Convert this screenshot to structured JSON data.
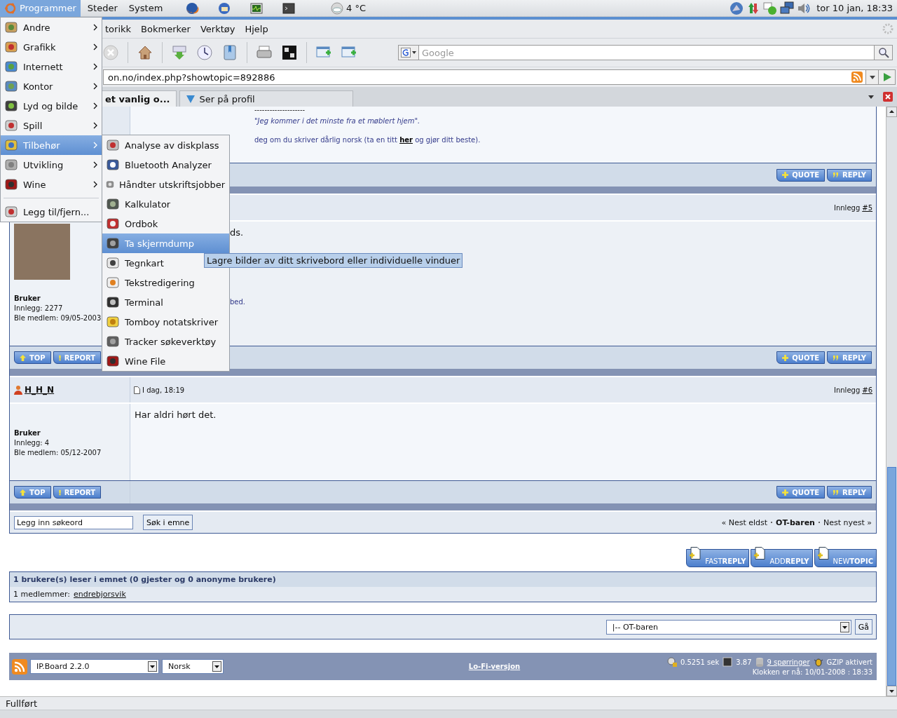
{
  "top_panel": {
    "menus": [
      {
        "label": "Programmer",
        "selected": true
      },
      {
        "label": "Steder",
        "selected": false
      },
      {
        "label": "System",
        "selected": false
      }
    ],
    "weather": "4 °C",
    "clock": "tor 10 jan, 18:33"
  },
  "app_menu": [
    {
      "label": "Andre",
      "submenu": true,
      "selected": false,
      "separator_before": false
    },
    {
      "label": "Grafikk",
      "submenu": true,
      "selected": false,
      "separator_before": false
    },
    {
      "label": "Internett",
      "submenu": true,
      "selected": false,
      "separator_before": false
    },
    {
      "label": "Kontor",
      "submenu": true,
      "selected": false,
      "separator_before": false
    },
    {
      "label": "Lyd og bilde",
      "submenu": true,
      "selected": false,
      "separator_before": false
    },
    {
      "label": "Spill",
      "submenu": true,
      "selected": false,
      "separator_before": false
    },
    {
      "label": "Tilbehør",
      "submenu": true,
      "selected": true,
      "separator_before": false
    },
    {
      "label": "Utvikling",
      "submenu": true,
      "selected": false,
      "separator_before": false
    },
    {
      "label": "Wine",
      "submenu": true,
      "selected": false,
      "separator_before": false
    },
    {
      "label": "Legg til/fjern...",
      "submenu": false,
      "selected": false,
      "separator_before": true
    }
  ],
  "submenu": [
    {
      "label": "Analyse av diskplass",
      "selected": false
    },
    {
      "label": "Bluetooth Analyzer",
      "selected": false
    },
    {
      "label": "Håndter utskriftsjobber",
      "selected": false
    },
    {
      "label": "Kalkulator",
      "selected": false
    },
    {
      "label": "Ordbok",
      "selected": false
    },
    {
      "label": "Ta skjermdump",
      "selected": true
    },
    {
      "label": "Tegnkart",
      "selected": false
    },
    {
      "label": "Tekstredigering",
      "selected": false
    },
    {
      "label": "Terminal",
      "selected": false
    },
    {
      "label": "Tomboy notatskriver",
      "selected": false
    },
    {
      "label": "Tracker søkeverktøy",
      "selected": false
    },
    {
      "label": "Wine File",
      "selected": false
    }
  ],
  "tooltip": "Lagre bilder av ditt skrivebord eller individuelle vinduer",
  "browser": {
    "menubar": [
      "torikk",
      "Bokmerker",
      "Verktøy",
      "Hjelp"
    ],
    "search": {
      "placeholder": "Google"
    },
    "url": "on.no/index.php?showtopic=892886",
    "tabs": [
      {
        "label": "et vanlig o...",
        "selected": true
      },
      {
        "label": "Ser på profil",
        "selected": false
      }
    ],
    "status": "Fullført"
  },
  "previous_post": {
    "signature_line": "--------------------",
    "quote": "\"Jeg kommer i det minste fra et møblert hjem\".",
    "note": {
      "before": "deg om du skriver dårlig norsk (ta en titt",
      "link": "her",
      "after": "og gjør ditt beste)."
    },
    "buttons_right": [
      "QUOTE",
      "REPLY"
    ]
  },
  "posts": [
    {
      "post_label": "Innlegg",
      "number": "#5",
      "avatar": true,
      "role": "Bruker",
      "post_count": "Innlegg: 2277",
      "joined": "Ble medlem: 09/05-2003",
      "body": [
        {
          "kind": "text",
          "text": "ds."
        },
        {
          "kind": "link",
          "text": "bed."
        }
      ],
      "buttons_left": [
        "TOP",
        "REPORT"
      ],
      "buttons_right": [
        "QUOTE",
        "REPLY"
      ]
    },
    {
      "author": "H_H_N",
      "date": "I dag, 18:19",
      "post_label": "Innlegg",
      "number": "#6",
      "avatar": false,
      "role": "Bruker",
      "post_count": "Innlegg: 4",
      "joined": "Ble medlem: 05/12-2007",
      "body": [
        {
          "kind": "text",
          "text": "Har aldri hørt det."
        }
      ],
      "buttons_left": [
        "TOP",
        "REPORT"
      ],
      "buttons_right": [
        "QUOTE",
        "REPLY"
      ]
    }
  ],
  "topic_search": {
    "placeholder": "Legg inn søkeord",
    "button": "Søk i emne",
    "nav_prev": "« Nest eldst",
    "nav_forum": "OT-baren",
    "nav_next": "Nest nyest »"
  },
  "topic_buttons": [
    {
      "light": "FAST",
      "bold": "REPLY"
    },
    {
      "light": "ADD",
      "bold": "REPLY"
    },
    {
      "light": "NEW",
      "bold": "TOPIC"
    }
  ],
  "active_users": {
    "title": "1 brukere(s) leser i emnet (0 gjester og 0 anonyme brukere)",
    "label": "1 medlemmer:",
    "members": [
      "endrebjorsvik"
    ]
  },
  "jump": {
    "value": "|-- OT-baren",
    "button": "Gå"
  },
  "footer": {
    "skin": "IP.Board 2.2.0",
    "language": "Norsk",
    "lofi": "Lo-Fi-versjon",
    "time": "0.5251 sek",
    "load": "3.87",
    "queries": "9 spørringer",
    "gzip": "GZIP aktivert",
    "clock": "Klokken er nå: 10/01-2008 : 18:33"
  }
}
